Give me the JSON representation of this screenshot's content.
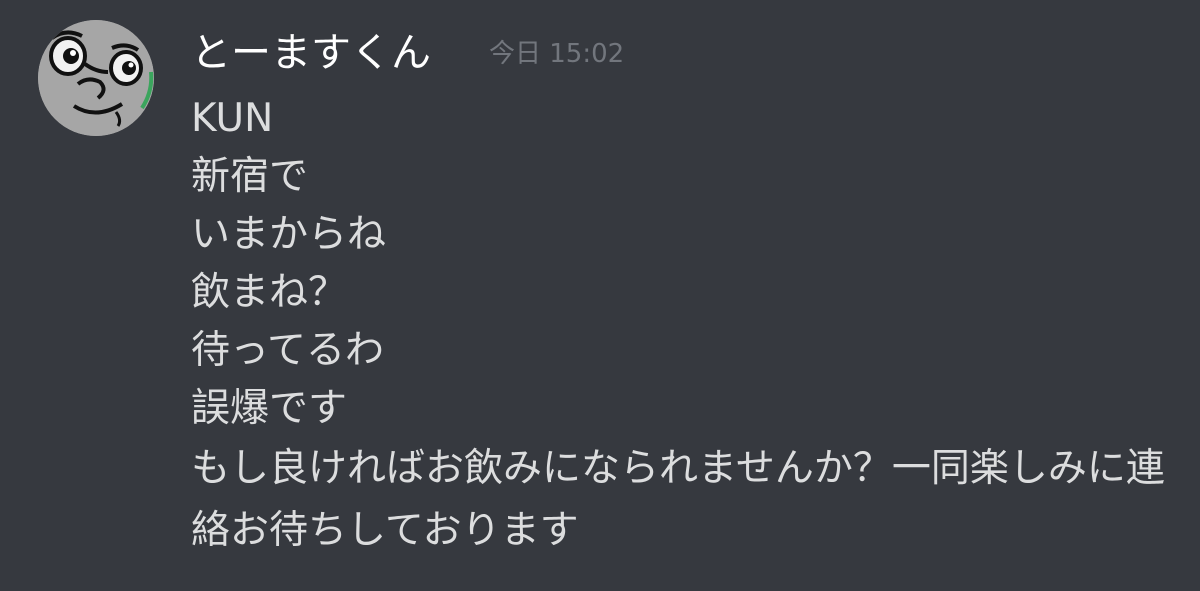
{
  "message": {
    "avatar_icon": "user-avatar-cartoon-face",
    "online_color": "#3ba55d",
    "username": "とーますくん",
    "timestamp": "今日 15:02",
    "lines": [
      "KUN",
      "新宿で",
      "いまからね",
      "飲まね？",
      "待ってるわ",
      "誤爆です",
      "もし良ければお飲みになられませんか？一同楽しみに連絡お待ちしております"
    ]
  },
  "colors": {
    "background": "#36393f",
    "username": "#ffffff",
    "text": "#dcddde",
    "timestamp": "#72767d"
  }
}
